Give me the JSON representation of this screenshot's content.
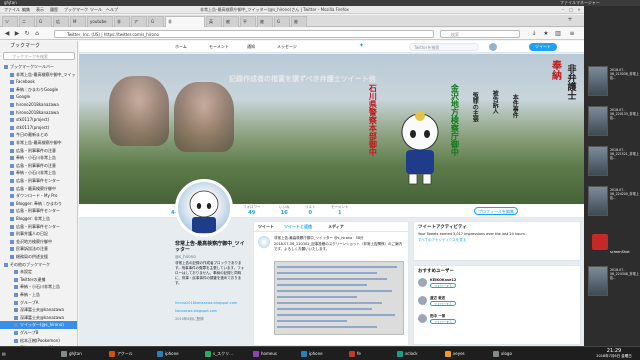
{
  "system_bar": {
    "left": "ghjtan",
    "right": "ファイルマネージャー"
  },
  "window": {
    "title": "非常上告-最高検察庁御中_ツイッター(@s_hirono)さん | Twitter - Mozilla Firefox",
    "menu": [
      "ファイル",
      "編集",
      "表示",
      "履歴",
      "ブックマーク",
      "ツール",
      "ヘルプ"
    ]
  },
  "tabs": [
    {
      "label": "ツ"
    },
    {
      "label": "ニ"
    },
    {
      "label": "G"
    },
    {
      "label": "広"
    },
    {
      "label": "M"
    },
    {
      "label": "youtube"
    },
    {
      "label": "非"
    },
    {
      "label": "ア"
    },
    {
      "label": "G"
    },
    {
      "label": "非"
    },
    {
      "label": "英"
    },
    {
      "label": "被"
    },
    {
      "label": "平"
    },
    {
      "label": "被"
    },
    {
      "label": "G"
    },
    {
      "label": "被"
    }
  ],
  "nav": {
    "url": "Twitter, Inc. (US) | https://twitter.com/s_hirono",
    "search_placeholder": "検索"
  },
  "sidebar": {
    "title": "ブックマーク",
    "search_placeholder": "ブックマークを検索",
    "items": [
      {
        "label": "ブックマークツールバー"
      },
      {
        "label": "非常上告-最高検察庁御中_ツイッ"
      },
      {
        "label": "Facebook"
      },
      {
        "label": "奉納｜ひまわりGoogle"
      },
      {
        "label": "Google"
      },
      {
        "label": "hirono2018kanazawa"
      },
      {
        "label": "hirono2018kanazawa"
      },
      {
        "label": "stk0117(project)"
      },
      {
        "label": "stk0117(project)"
      },
      {
        "label": "今日の最新まとめ"
      },
      {
        "label": "非常上告-最高検察庁御中"
      },
      {
        "label": "広島・刑事事件の注意"
      },
      {
        "label": "奉納・小石川非常上告"
      },
      {
        "label": "広島・刑事事件の注意"
      },
      {
        "label": "奉納・小石川非常上告"
      },
      {
        "label": "広島・刑事事件センター"
      },
      {
        "label": "広島・最高検察庁御中"
      },
      {
        "label": "ダウンロード・My Pro"
      },
      {
        "label": "Blogger: 奉納｜ひまわり"
      },
      {
        "label": "広島・刑事事件センター"
      },
      {
        "label": "Blogger: 非常上告"
      },
      {
        "label": "広島・刑事事件センター"
      },
      {
        "label": "刑事弁護人の日記"
      },
      {
        "label": "金沢地方検察庁御中"
      },
      {
        "label": "民事訴訟法の注意"
      },
      {
        "label": "総務局の供述支援"
      },
      {
        "label": "その他のブックマーク"
      },
      {
        "label": "未設定"
      },
      {
        "label": "Twitterの逮捕"
      },
      {
        "label": "奉納・小石川非常上告"
      },
      {
        "label": "奉納・上告"
      },
      {
        "label": "グループA"
      },
      {
        "label": "深澤富士夫@kanazawa"
      },
      {
        "label": "深澤富士夫@kanazawa"
      },
      {
        "label": "ツイッター(@s_hirono)"
      },
      {
        "label": "グループB"
      },
      {
        "label": "松本正樹(Pookemon)"
      },
      {
        "label": "奉納｜ひまわり(Mojo)"
      }
    ]
  },
  "twitter": {
    "nav": {
      "home": "ホーム",
      "moments": "モーメント",
      "notifications": "通知",
      "messages": "メッセージ",
      "search_placeholder": "Twitterを検索",
      "tweet_button": "ツイート"
    },
    "banner": {
      "top_text": "記録作成者の措置を講ずべき弁護士ツイート他",
      "red_text": "石川県警察本部御中",
      "green_text": "金沢地方検察庁御中",
      "column1": "冤罪の主張",
      "column2": "被告訴人",
      "column3": "本件事件",
      "right_red": "奉納",
      "right_black": "非弁護士"
    },
    "stats": [
      {
        "label": "ツイート",
        "value": "44,967"
      },
      {
        "label": "フォロー",
        "value": "9"
      },
      {
        "label": "フォロワー",
        "value": "49"
      },
      {
        "label": "いいね",
        "value": "16"
      },
      {
        "label": "リスト",
        "value": "0"
      },
      {
        "label": "モーメント",
        "value": "1"
      }
    ],
    "follow_button": "プロフィールを編集",
    "profile": {
      "name": "非常上告-最高検察庁御中_ツイッター",
      "handle": "@s_hirono",
      "bio": "非常上告の記録の作成者ブロックであります。刑事事件の冤罪を主張しています。フォローはしておりません。奉納の記録と同時に、刑事・民事事件の調査を進めております。",
      "link1": "hirono2018kanazawa.blogspot.com",
      "link2": "kanazawa.blogspot.com",
      "joined": "2010年6月に登録"
    },
    "timeline_tabs": [
      "ツイート",
      "ツイートと返信",
      "メディア"
    ],
    "tweet": {
      "header": "非常上告-最高検察庁御中_ツイッター @s_hirono · 58分",
      "body": "2018-07-06_220302_記事投稿のスクリーンショット（非常上告関係）のご案内です。よろしくお願いいたします。"
    },
    "activity": {
      "title": "ツイートアクティビティ",
      "text": "Your Tweets earned 3,017 impressions over the last 24 hours",
      "link": "すべてのアナリティクスを見る"
    },
    "recommend": {
      "title": "おすすめユーザー",
      "users": [
        {
          "name": "KEIKOKase12",
          "btn": "フォローする"
        },
        {
          "name": "渡辺 敦志",
          "btn": "フォローする"
        },
        {
          "name": "田中 一郎",
          "btn": "フォローする"
        }
      ]
    }
  },
  "desktop": {
    "files": [
      {
        "label": "2018-07-06_215036_非常上告..."
      },
      {
        "label": "2018-07-06_220133_非常上告..."
      },
      {
        "label": "2018-07-06_221521_非常上告..."
      },
      {
        "label": "2018-07-06_224200_非常上告..."
      },
      {
        "label": "2018-07-06_224348_非常上告..."
      }
    ],
    "screenshot_label": "screenShot"
  },
  "taskbar": {
    "apps": [
      "ghjtan",
      "アクール",
      "iphone",
      "s_スクリ...",
      "homeus",
      "iphone",
      "fe",
      "xclock",
      "xeyes",
      "xlogo"
    ],
    "clock_time": "21:29",
    "clock_date": "2018年7月6日 金曜日"
  }
}
